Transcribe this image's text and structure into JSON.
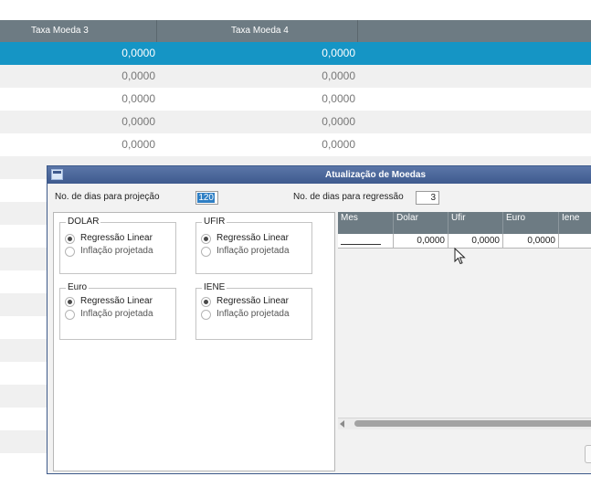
{
  "background_table": {
    "columns": [
      "Taxa Moeda 3",
      "Taxa Moeda 4"
    ],
    "rows": [
      [
        "0,0000",
        "0,0000"
      ],
      [
        "0,0000",
        "0,0000"
      ],
      [
        "0,0000",
        "0,0000"
      ],
      [
        "0,0000",
        "0,0000"
      ],
      [
        "0,0000",
        "0,0000"
      ]
    ]
  },
  "dialog": {
    "title": "Atualização de Moedas",
    "proj_days_label": "No. de dias para projeção",
    "proj_days_value": "120",
    "regr_days_label": "No. de dias para regressão",
    "regr_days_value": "3",
    "groups": [
      {
        "legend": "DOLAR",
        "opt1": "Regressão Linear",
        "opt2": "Inflação projetada"
      },
      {
        "legend": "UFIR",
        "opt1": "Regressão Linear",
        "opt2": "Inflação projetada"
      },
      {
        "legend": "Euro",
        "opt1": "Regressão Linear",
        "opt2": "Inflação projetada"
      },
      {
        "legend": "IENE",
        "opt1": "Regressão Linear",
        "opt2": "Inflação projetada"
      }
    ],
    "grid": {
      "headers": [
        "Mes",
        "Dolar",
        "Ufir",
        "Euro",
        "Iene"
      ],
      "row": [
        "",
        "0,0000",
        "0,0000",
        "0,0000",
        ""
      ]
    }
  },
  "colors": {
    "header_bg": "#6d7b83",
    "selected_row": "#1595c5",
    "title_bar": "#3e5a8e"
  }
}
